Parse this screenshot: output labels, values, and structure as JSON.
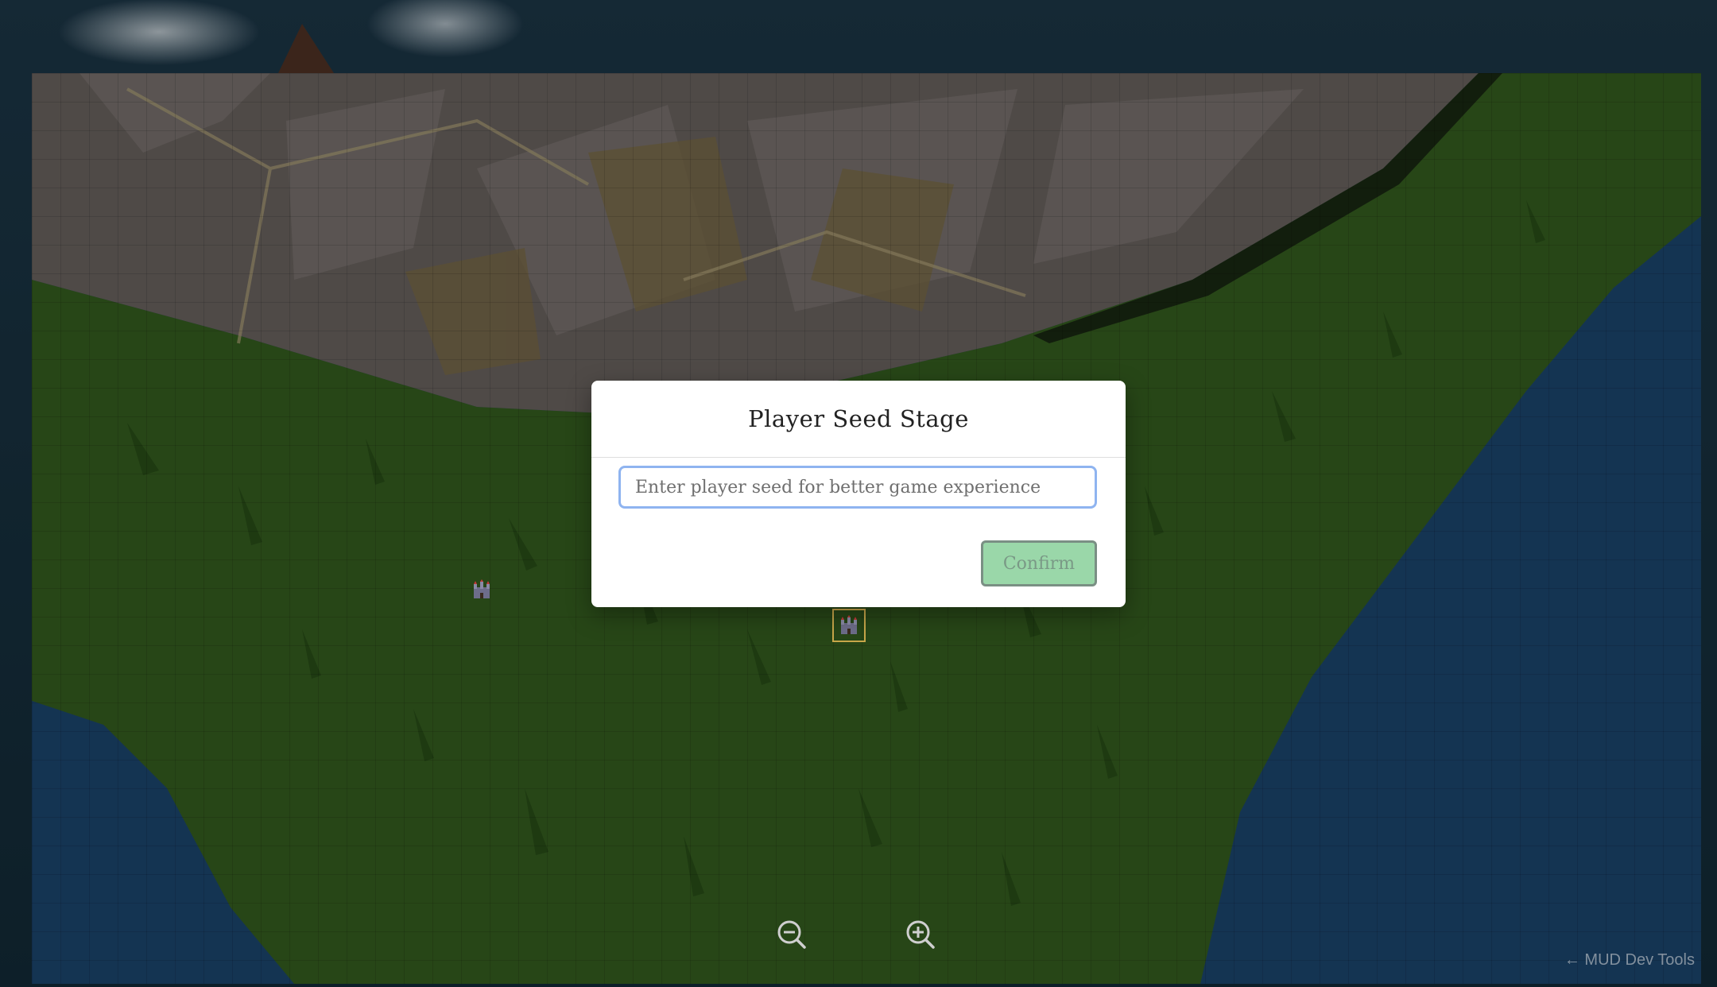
{
  "modal": {
    "title": "Player Seed Stage",
    "input_value": "",
    "input_placeholder": "Enter player seed for better game experience",
    "confirm_label": "Confirm"
  },
  "devtools": {
    "label": "← MUD Dev Tools"
  },
  "map": {
    "castles": [
      {
        "name": "castle-1",
        "selected": false
      },
      {
        "name": "castle-2",
        "selected": true
      }
    ]
  },
  "controls": {
    "zoom_out_icon": "zoom-out-icon",
    "zoom_in_icon": "zoom-in-icon"
  },
  "colors": {
    "grass": "#3f6f25",
    "ocean": "#1e4f82",
    "mountain": "#6b6462",
    "confirm_bg": "#9ad7a9",
    "input_border": "#8fb4f0"
  }
}
